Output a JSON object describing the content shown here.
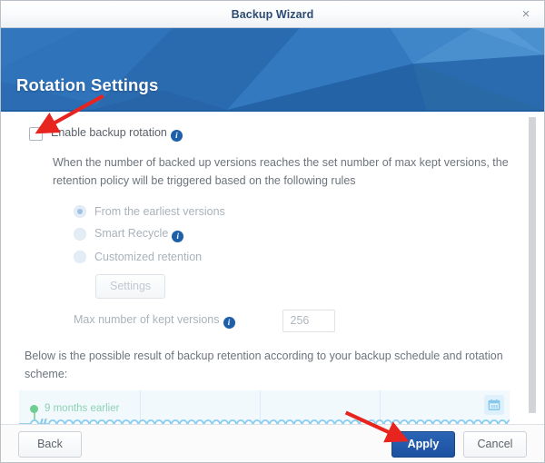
{
  "titlebar": {
    "title": "Backup Wizard",
    "close_label": "×"
  },
  "header": {
    "title": "Rotation Settings"
  },
  "form": {
    "enable_rotation_label": "Enable backup rotation",
    "info_glyph": "i",
    "description": "When the number of backed up versions reaches the set number of max kept versions, the retention policy will be triggered based on the following rules",
    "radio_options": [
      {
        "label": "From the earliest versions",
        "selected": true,
        "has_info": false
      },
      {
        "label": "Smart Recycle",
        "selected": false,
        "has_info": true
      },
      {
        "label": "Customized retention",
        "selected": false,
        "has_info": false
      }
    ],
    "settings_button_label": "Settings",
    "max_versions_label": "Max number of kept versions",
    "max_versions_value": "256",
    "preview_description": "Below is the possible result of backup retention according to your backup schedule and rotation scheme:"
  },
  "timeline": {
    "marker_label": "9 months earlier",
    "marker_color": "#6ece8f",
    "line_color": "#9bd2ef",
    "dot_border_color": "#8fcfee",
    "background": "#f1f9fd",
    "calendar_icon": "calendar-icon",
    "dot_count": 60
  },
  "footer": {
    "back_label": "Back",
    "apply_label": "Apply",
    "cancel_label": "Cancel"
  },
  "annotations": {
    "arrow_color": "#e8241f",
    "arrow_checkbox_target": "enable-backup-rotation-checkbox",
    "arrow_apply_target": "apply-button"
  },
  "colors": {
    "banner_blue": "#2e71b8",
    "primary_button": "#1d50a0",
    "info_icon_blue": "#1d5fa8",
    "title_text": "#2c4a72"
  }
}
